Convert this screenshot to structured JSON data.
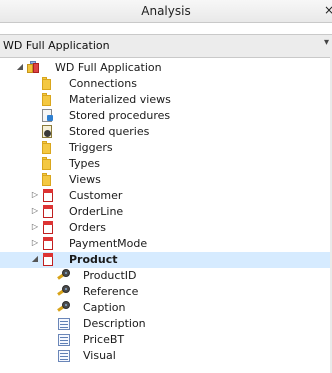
{
  "window": {
    "title": "Analysis",
    "close_glyph": "×"
  },
  "selector": {
    "value": "WD Full Application",
    "arrow_glyph": "▾"
  },
  "tree": {
    "root": {
      "label": "WD Full Application",
      "expanded": true,
      "icon": "database-icon"
    },
    "folders": [
      {
        "label": "Connections",
        "icon": "folder-icon"
      },
      {
        "label": "Materialized views",
        "icon": "folder-icon"
      },
      {
        "label": "Stored procedures",
        "icon": "stored-procedure-icon"
      },
      {
        "label": "Stored queries",
        "icon": "stored-query-icon"
      },
      {
        "label": "Triggers",
        "icon": "folder-icon"
      },
      {
        "label": "Types",
        "icon": "folder-icon"
      },
      {
        "label": "Views",
        "icon": "folder-icon"
      }
    ],
    "tables": [
      {
        "label": "Customer",
        "expanded": false,
        "icon": "table-icon"
      },
      {
        "label": "OrderLine",
        "expanded": false,
        "icon": "table-icon"
      },
      {
        "label": "Orders",
        "expanded": false,
        "icon": "table-icon"
      },
      {
        "label": "PaymentMode",
        "expanded": false,
        "icon": "table-icon"
      },
      {
        "label": "Product",
        "expanded": true,
        "selected": true,
        "icon": "table-icon"
      }
    ],
    "product_fields": [
      {
        "label": "ProductID",
        "icon": "key-icon"
      },
      {
        "label": "Reference",
        "icon": "key-icon"
      },
      {
        "label": "Caption",
        "icon": "key-icon"
      },
      {
        "label": "Description",
        "icon": "field-icon"
      },
      {
        "label": "PriceBT",
        "icon": "field-icon"
      },
      {
        "label": "Visual",
        "icon": "field-icon"
      }
    ]
  },
  "colors": {
    "selection": "#d6ebff",
    "folder": "#f4c842",
    "table_red": "#d33333"
  }
}
